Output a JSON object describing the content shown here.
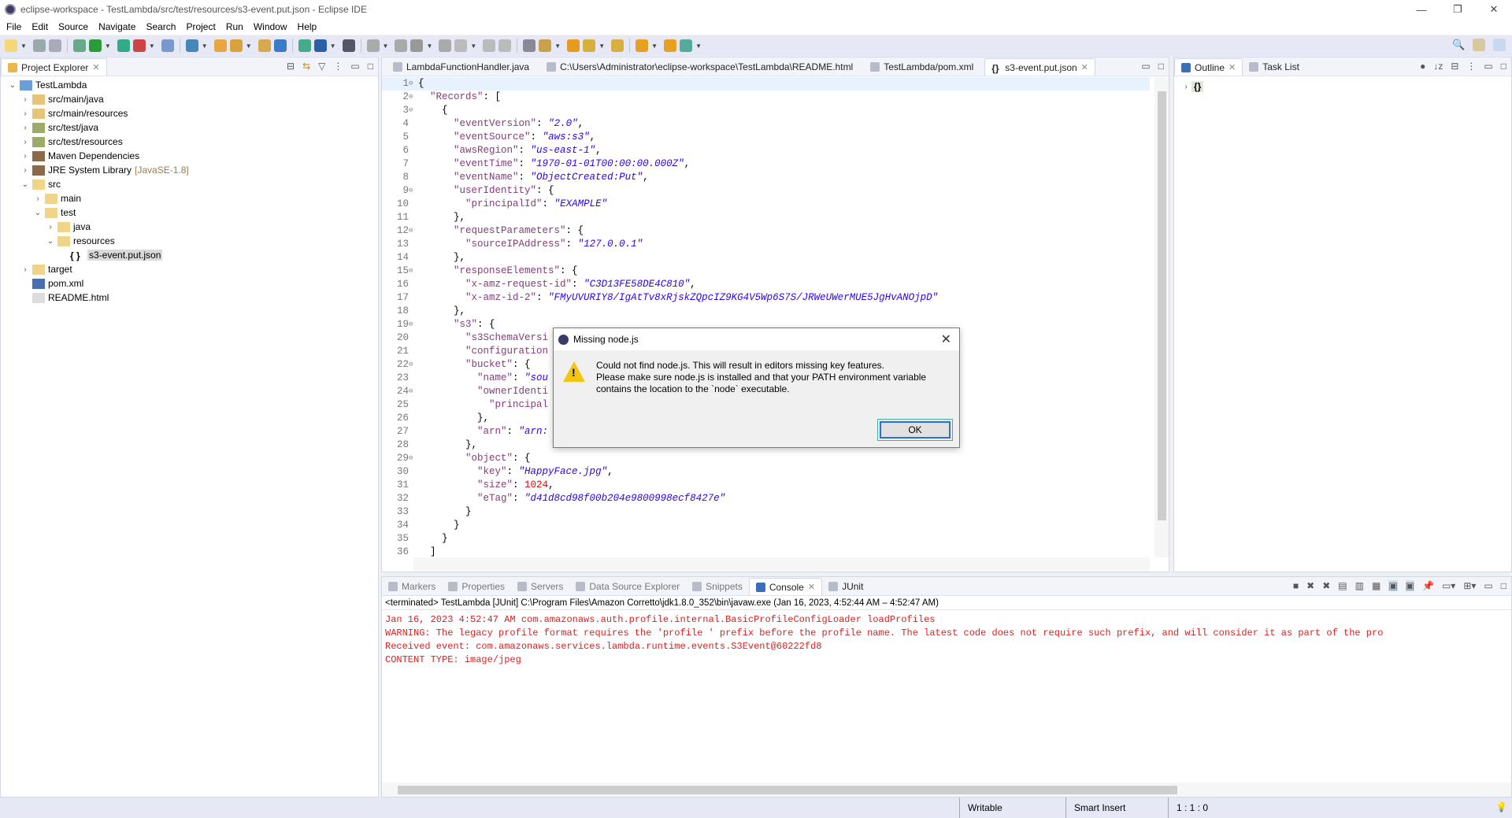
{
  "window": {
    "title": "eclipse-workspace - TestLambda/src/test/resources/s3-event.put.json - Eclipse IDE",
    "minimize": "—",
    "restore": "❐",
    "close": "✕"
  },
  "menu": [
    "File",
    "Edit",
    "Source",
    "Navigate",
    "Search",
    "Project",
    "Run",
    "Window",
    "Help"
  ],
  "toolbar": {
    "icons": [
      "new",
      "save",
      "save-all",
      "debug",
      "run",
      "run-coverage",
      "external-tools",
      "new-java-project",
      "new-class",
      "open-type",
      "open-task",
      "search",
      "globe",
      "open-perspective",
      "console",
      "skip-breakpoints",
      "resume",
      "suspend",
      "terminate",
      "disconnect",
      "step-into",
      "step-over",
      "step-return",
      "word-wrap",
      "toggle-mark",
      "java-element",
      "next-annotation",
      "previous-annotation",
      "back",
      "forward",
      "pin"
    ],
    "right_icons": [
      "search",
      "open-perspective",
      "java-ee-perspective"
    ]
  },
  "explorer": {
    "title": "Project Explorer",
    "tree": [
      {
        "label": "TestLambda",
        "depth": 0,
        "toggle": "open",
        "icon": "project"
      },
      {
        "label": "src/main/java",
        "depth": 1,
        "toggle": "closed",
        "icon": "source-folder"
      },
      {
        "label": "src/main/resources",
        "depth": 1,
        "toggle": "closed",
        "icon": "source-folder"
      },
      {
        "label": "src/test/java",
        "depth": 1,
        "toggle": "closed",
        "icon": "test-source-folder"
      },
      {
        "label": "src/test/resources",
        "depth": 1,
        "toggle": "closed",
        "icon": "test-source-folder"
      },
      {
        "label": "Maven Dependencies",
        "depth": 1,
        "toggle": "closed",
        "icon": "library"
      },
      {
        "label": "JRE System Library",
        "decor": "[JavaSE-1.8]",
        "depth": 1,
        "toggle": "closed",
        "icon": "library"
      },
      {
        "label": "src",
        "depth": 1,
        "toggle": "open",
        "icon": "folder"
      },
      {
        "label": "main",
        "depth": 2,
        "toggle": "closed",
        "icon": "folder"
      },
      {
        "label": "test",
        "depth": 2,
        "toggle": "open",
        "icon": "folder"
      },
      {
        "label": "java",
        "depth": 3,
        "toggle": "closed",
        "icon": "folder"
      },
      {
        "label": "resources",
        "depth": 3,
        "toggle": "open",
        "icon": "folder"
      },
      {
        "label": "s3-event.put.json",
        "depth": 4,
        "toggle": "",
        "icon": "json",
        "selected": true
      },
      {
        "label": "target",
        "depth": 1,
        "toggle": "closed",
        "icon": "folder"
      },
      {
        "label": "pom.xml",
        "depth": 1,
        "toggle": "",
        "icon": "maven"
      },
      {
        "label": "README.html",
        "depth": 1,
        "toggle": "",
        "icon": "html"
      }
    ]
  },
  "editor": {
    "tabs": [
      {
        "label": "LambdaFunctionHandler.java",
        "icon": "java"
      },
      {
        "label": "C:\\Users\\Administrator\\eclipse-workspace\\TestLambda\\README.html",
        "icon": "globe"
      },
      {
        "label": "TestLambda/pom.xml",
        "icon": "maven"
      },
      {
        "label": "s3-event.put.json",
        "icon": "json",
        "active": true
      }
    ],
    "lines": [
      [
        [
          "p",
          "{"
        ]
      ],
      [
        [
          "p",
          "  "
        ],
        [
          "k",
          "\"Records\""
        ],
        [
          "p",
          ": ["
        ]
      ],
      [
        [
          "p",
          "    {"
        ]
      ],
      [
        [
          "p",
          "      "
        ],
        [
          "k",
          "\"eventVersion\""
        ],
        [
          "p",
          ": "
        ],
        [
          "s",
          "\"2.0\""
        ],
        [
          "p",
          ","
        ]
      ],
      [
        [
          "p",
          "      "
        ],
        [
          "k",
          "\"eventSource\""
        ],
        [
          "p",
          ": "
        ],
        [
          "s",
          "\"aws:s3\""
        ],
        [
          "p",
          ","
        ]
      ],
      [
        [
          "p",
          "      "
        ],
        [
          "k",
          "\"awsRegion\""
        ],
        [
          "p",
          ": "
        ],
        [
          "s",
          "\"us-east-1\""
        ],
        [
          "p",
          ","
        ]
      ],
      [
        [
          "p",
          "      "
        ],
        [
          "k",
          "\"eventTime\""
        ],
        [
          "p",
          ": "
        ],
        [
          "s",
          "\"1970-01-01T00:00:00.000Z\""
        ],
        [
          "p",
          ","
        ]
      ],
      [
        [
          "p",
          "      "
        ],
        [
          "k",
          "\"eventName\""
        ],
        [
          "p",
          ": "
        ],
        [
          "s",
          "\"ObjectCreated:Put\""
        ],
        [
          "p",
          ","
        ]
      ],
      [
        [
          "p",
          "      "
        ],
        [
          "k",
          "\"userIdentity\""
        ],
        [
          "p",
          ": {"
        ]
      ],
      [
        [
          "p",
          "        "
        ],
        [
          "k",
          "\"principalId\""
        ],
        [
          "p",
          ": "
        ],
        [
          "s",
          "\"EXAMPLE\""
        ]
      ],
      [
        [
          "p",
          "      },"
        ]
      ],
      [
        [
          "p",
          "      "
        ],
        [
          "k",
          "\"requestParameters\""
        ],
        [
          "p",
          ": {"
        ]
      ],
      [
        [
          "p",
          "        "
        ],
        [
          "k",
          "\"sourceIPAddress\""
        ],
        [
          "p",
          ": "
        ],
        [
          "s",
          "\"127.0.0.1\""
        ]
      ],
      [
        [
          "p",
          "      },"
        ]
      ],
      [
        [
          "p",
          "      "
        ],
        [
          "k",
          "\"responseElements\""
        ],
        [
          "p",
          ": {"
        ]
      ],
      [
        [
          "p",
          "        "
        ],
        [
          "k",
          "\"x-amz-request-id\""
        ],
        [
          "p",
          ": "
        ],
        [
          "s",
          "\"C3D13FE58DE4C810\""
        ],
        [
          "p",
          ","
        ]
      ],
      [
        [
          "p",
          "        "
        ],
        [
          "k",
          "\"x-amz-id-2\""
        ],
        [
          "p",
          ": "
        ],
        [
          "s",
          "\"FMyUVURIY8/IgAtTv8xRjskZQpcIZ9KG4V5Wp6S7S/JRWeUWerMUE5JgHvANOjpD\""
        ]
      ],
      [
        [
          "p",
          "      },"
        ]
      ],
      [
        [
          "p",
          "      "
        ],
        [
          "k",
          "\"s3\""
        ],
        [
          "p",
          ": {"
        ]
      ],
      [
        [
          "p",
          "        "
        ],
        [
          "k",
          "\"s3SchemaVersi"
        ]
      ],
      [
        [
          "p",
          "        "
        ],
        [
          "k",
          "\"configuration"
        ]
      ],
      [
        [
          "p",
          "        "
        ],
        [
          "k",
          "\"bucket\""
        ],
        [
          "p",
          ": {"
        ]
      ],
      [
        [
          "p",
          "          "
        ],
        [
          "k",
          "\"name\""
        ],
        [
          "p",
          ": "
        ],
        [
          "s",
          "\"sou"
        ]
      ],
      [
        [
          "p",
          "          "
        ],
        [
          "k",
          "\"ownerIdenti"
        ]
      ],
      [
        [
          "p",
          "            "
        ],
        [
          "k",
          "\"principal"
        ]
      ],
      [
        [
          "p",
          "          },"
        ]
      ],
      [
        [
          "p",
          "          "
        ],
        [
          "k",
          "\"arn\""
        ],
        [
          "p",
          ": "
        ],
        [
          "s",
          "\"arn:"
        ]
      ],
      [
        [
          "p",
          "        },"
        ]
      ],
      [
        [
          "p",
          "        "
        ],
        [
          "k",
          "\"object\""
        ],
        [
          "p",
          ": {"
        ]
      ],
      [
        [
          "p",
          "          "
        ],
        [
          "k",
          "\"key\""
        ],
        [
          "p",
          ": "
        ],
        [
          "s",
          "\"HappyFace.jpg\""
        ],
        [
          "p",
          ","
        ]
      ],
      [
        [
          "p",
          "          "
        ],
        [
          "k",
          "\"size\""
        ],
        [
          "p",
          ": "
        ],
        [
          "n",
          "1024"
        ],
        [
          "p",
          ","
        ]
      ],
      [
        [
          "p",
          "          "
        ],
        [
          "k",
          "\"eTag\""
        ],
        [
          "p",
          ": "
        ],
        [
          "s",
          "\"d41d8cd98f00b204e9800998ecf8427e\""
        ]
      ],
      [
        [
          "p",
          "        }"
        ]
      ],
      [
        [
          "p",
          "      }"
        ]
      ],
      [
        [
          "p",
          "    }"
        ]
      ],
      [
        [
          "p",
          "  ]"
        ]
      ]
    ],
    "foldable": [
      1,
      2,
      3,
      9,
      12,
      15,
      19,
      22,
      24,
      29
    ]
  },
  "outline": {
    "tabs": [
      {
        "label": "Outline",
        "active": true
      },
      {
        "label": "Task List"
      }
    ],
    "root": "{}"
  },
  "console": {
    "tabs": [
      {
        "label": "Markers"
      },
      {
        "label": "Properties"
      },
      {
        "label": "Servers"
      },
      {
        "label": "Data Source Explorer"
      },
      {
        "label": "Snippets"
      },
      {
        "label": "Console",
        "active": true
      },
      {
        "label": "JUnit"
      }
    ],
    "process": "<terminated> TestLambda [JUnit] C:\\Program Files\\Amazon Corretto\\jdk1.8.0_352\\bin\\javaw.exe  (Jan 16, 2023, 4:52:44 AM – 4:52:47 AM)",
    "output": [
      "Jan 16, 2023 4:52:47 AM com.amazonaws.auth.profile.internal.BasicProfileConfigLoader loadProfiles",
      "WARNING: The legacy profile format requires the 'profile ' prefix before the profile name. The latest code does not require such prefix, and will consider it as part of the pro",
      "Received event: com.amazonaws.services.lambda.runtime.events.S3Event@60222fd8",
      "CONTENT TYPE: image/jpeg"
    ]
  },
  "status": {
    "writable": "Writable",
    "insert_mode": "Smart Insert",
    "position": "1 : 1 : 0"
  },
  "dialog": {
    "title": "Missing node.js",
    "lines": [
      "Could not find node.js. This will result in editors missing key features.",
      "Please make sure node.js is installed and that your PATH environment variable",
      "contains the location to the `node` executable."
    ],
    "ok": "OK"
  },
  "colors": {
    "json_key": "#863b7a",
    "json_string": "#2a00ff",
    "json_number": "#ee0000",
    "console_error": "#e02020",
    "dialog_focus": "#2d6fd6"
  }
}
